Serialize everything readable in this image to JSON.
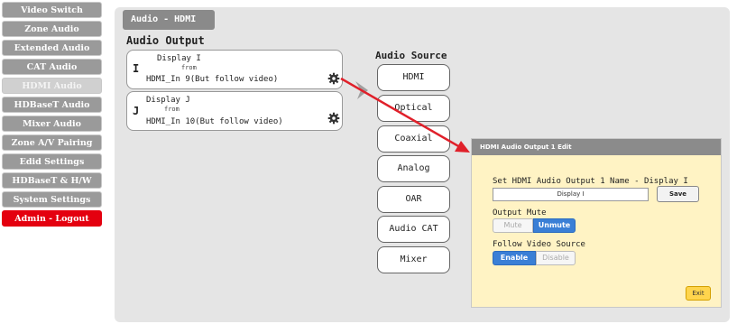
{
  "sidebar": {
    "items": [
      {
        "label": "Video Switch"
      },
      {
        "label": "Zone Audio"
      },
      {
        "label": "Extended Audio"
      },
      {
        "label": "CAT Audio"
      },
      {
        "label": "HDMI Audio"
      },
      {
        "label": "HDBaseT Audio"
      },
      {
        "label": "Mixer Audio"
      },
      {
        "label": "Zone A/V Pairing"
      },
      {
        "label": "Edid Settings"
      },
      {
        "label": "HDBaseT & H/W"
      },
      {
        "label": "System Settings"
      },
      {
        "label": "Admin - Logout"
      }
    ],
    "active_index": 4
  },
  "panel": {
    "tab_label": "Audio - HDMI"
  },
  "audio_output": {
    "title": "Audio Output",
    "outputs": [
      {
        "letter": "I",
        "display": "Display I",
        "from_label": "from",
        "source": "HDMI_In 9(But follow video)",
        "gear_icon": "gear-icon"
      },
      {
        "letter": "J",
        "display": "Display J",
        "from_label": "from",
        "source": "HDMI_In 10(But follow video)",
        "gear_icon": "gear-icon"
      }
    ]
  },
  "audio_source": {
    "title": "Audio Source",
    "buttons": [
      "HDMI",
      "Optical",
      "Coaxial",
      "Analog",
      "OAR",
      "Audio CAT",
      "Mixer"
    ]
  },
  "dialog": {
    "title": "HDMI Audio Output 1 Edit",
    "name_label": "Set HDMI Audio Output 1 Name - Display I",
    "name_value": "Display I",
    "save_label": "Save",
    "mute_label": "Output Mute",
    "mute_option": "Mute",
    "unmute_option": "Unmute",
    "mute_selected": "Unmute",
    "follow_label": "Follow Video Source",
    "enable_option": "Enable",
    "disable_option": "Disable",
    "follow_selected": "Enable",
    "exit_label": "Exit"
  },
  "colors": {
    "sidebar_bg": "#9a9a9a",
    "logout_bg": "#e4000f",
    "panel_bg": "#e5e5e5",
    "dialog_bg": "#fff3c4",
    "selected_toggle": "#3a7fd6",
    "arrow": "#e0202a"
  }
}
